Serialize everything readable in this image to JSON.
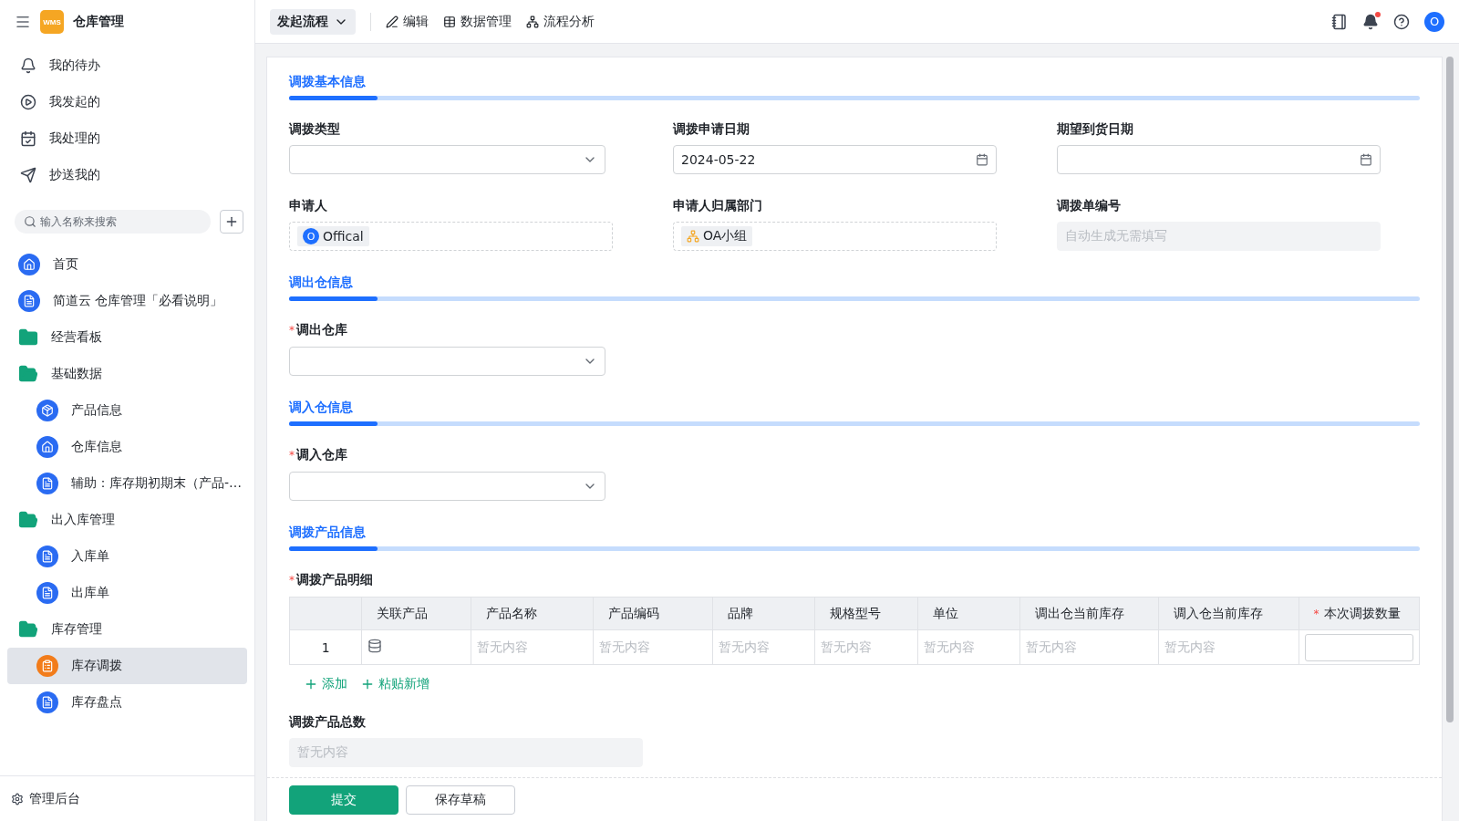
{
  "app": {
    "title": "仓库管理",
    "logo": "WMS"
  },
  "quick_links": [
    {
      "kind": "bell",
      "label": "我的待办"
    },
    {
      "kind": "play",
      "label": "我发起的"
    },
    {
      "kind": "inbox",
      "label": "我处理的"
    },
    {
      "kind": "send",
      "label": "抄送我的"
    }
  ],
  "search": {
    "placeholder": "输入名称来搜索"
  },
  "nav": [
    {
      "kind": "home",
      "label": "首页",
      "selected": false
    },
    {
      "kind": "doc",
      "label": "简道云 仓库管理「必看说明」",
      "selected": false
    },
    {
      "kind": "folder",
      "label": "经营看板",
      "selected": false
    },
    {
      "kind": "folder-open",
      "label": "基础数据",
      "selected": false,
      "children": [
        {
          "kind": "box",
          "label": "产品信息",
          "selected": false
        },
        {
          "kind": "home",
          "label": "仓库信息",
          "selected": false
        },
        {
          "kind": "doc",
          "label": "辅助：库存期初期末（产品-…",
          "selected": false
        }
      ]
    },
    {
      "kind": "folder-open",
      "label": "出入库管理",
      "selected": false,
      "children": [
        {
          "kind": "doc",
          "label": "入库单",
          "selected": false
        },
        {
          "kind": "doc",
          "label": "出库单",
          "selected": false
        }
      ]
    },
    {
      "kind": "folder-open",
      "label": "库存管理",
      "selected": false,
      "children": [
        {
          "kind": "form",
          "label": "库存调拨",
          "selected": true
        },
        {
          "kind": "doc",
          "label": "库存盘点",
          "selected": false
        }
      ]
    }
  ],
  "admin_link": "管理后台",
  "toolbar": {
    "launch": "发起流程",
    "items": [
      {
        "kind": "edit",
        "label": "编辑"
      },
      {
        "kind": "data",
        "label": "数据管理"
      },
      {
        "kind": "flow",
        "label": "流程分析"
      }
    ],
    "notification_dot": true,
    "avatar": "O"
  },
  "sections": [
    {
      "title": "调拨基本信息",
      "fields": [
        {
          "kind": "select",
          "label": "调拨类型"
        },
        {
          "kind": "date",
          "label": "调拨申请日期",
          "value": "2024-05-22"
        },
        {
          "kind": "date",
          "label": "期望到货日期"
        },
        {
          "kind": "user",
          "label": "申请人",
          "value": "Offical",
          "avatar": "O"
        },
        {
          "kind": "dept",
          "label": "申请人归属部门",
          "value": "OA小组"
        },
        {
          "kind": "readonly",
          "label": "调拨单编号",
          "placeholder": "自动生成无需填写"
        }
      ]
    },
    {
      "title": "调出仓信息",
      "fields": [
        {
          "kind": "select",
          "label": "调出仓库",
          "required_mark": "*"
        }
      ]
    },
    {
      "title": "调入仓信息",
      "fields": [
        {
          "kind": "select",
          "label": "调入仓库",
          "required_mark": "*"
        }
      ]
    },
    {
      "title": "调拨产品信息",
      "fields": [
        {
          "kind": "table",
          "label": "调拨产品明细",
          "required_mark": "*",
          "columns": [
            {},
            {
              "label": "关联产品"
            },
            {
              "label": "产品名称"
            },
            {
              "label": "产品编码"
            },
            {
              "label": "品牌"
            },
            {
              "label": "规格型号"
            },
            {
              "label": "单位"
            },
            {
              "label": "调出仓当前库存"
            },
            {
              "label": "调入仓当前库存"
            },
            {
              "label": "本次调拨数量",
              "required_mark": "*"
            }
          ],
          "rows": [
            {
              "cells": [
                {
                  "kind": "index",
                  "text": "1"
                },
                {
                  "kind": "picker"
                },
                {
                  "kind": "empty",
                  "text": "暂无内容"
                },
                {
                  "kind": "empty",
                  "text": "暂无内容"
                },
                {
                  "kind": "empty",
                  "text": "暂无内容"
                },
                {
                  "kind": "empty",
                  "text": "暂无内容"
                },
                {
                  "kind": "empty",
                  "text": "暂无内容"
                },
                {
                  "kind": "empty",
                  "text": "暂无内容"
                },
                {
                  "kind": "empty",
                  "text": "暂无内容"
                },
                {
                  "kind": "input"
                }
              ]
            }
          ],
          "actions": [
            "添加",
            "粘贴新增"
          ]
        },
        {
          "kind": "readonly-half",
          "label": "调拨产品总数",
          "placeholder": "暂无内容"
        }
      ]
    }
  ],
  "footer_buttons": [
    {
      "kind": "primary",
      "label": "提交"
    },
    {
      "kind": "secondary",
      "label": "保存草稿"
    }
  ]
}
